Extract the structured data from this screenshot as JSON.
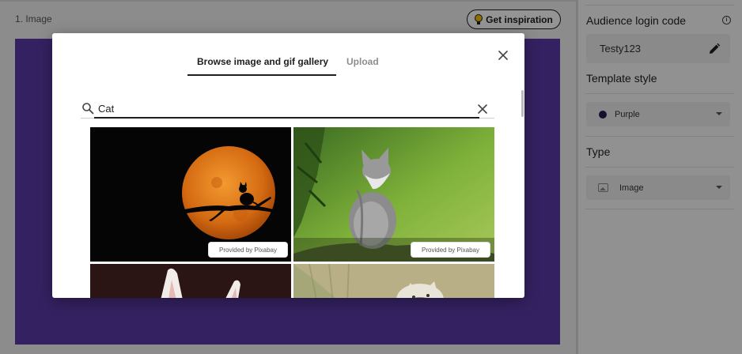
{
  "editor": {
    "slide_label": "1. Image",
    "inspiration_button": "Get inspiration",
    "canvas_color": "#5a3aa8"
  },
  "settings": {
    "login_code_title": "Audience login code",
    "login_code_value": "Testy123",
    "template_style_title": "Template style",
    "template_style_value": "Purple",
    "template_style_swatch": "#281a52",
    "type_title": "Type",
    "type_value": "Image"
  },
  "modal": {
    "tabs": [
      {
        "label": "Browse image and gif gallery",
        "active": true
      },
      {
        "label": "Upload",
        "active": false
      }
    ],
    "search_value": "Cat",
    "results": [
      {
        "credit": "Provided by Pixabay",
        "subject": "cat-on-branch-moon"
      },
      {
        "credit": "Provided by Pixabay",
        "subject": "kitten-in-grass"
      },
      {
        "subject": "white-cat-ears"
      },
      {
        "subject": "cat-in-field"
      }
    ]
  },
  "icons": {
    "inspiration": "lightbulb-icon",
    "info": "info-icon",
    "edit": "pencil-icon",
    "close": "close-icon",
    "search": "search-icon",
    "clear": "clear-icon",
    "type": "image-icon",
    "dropdown": "chevron-down-icon"
  }
}
